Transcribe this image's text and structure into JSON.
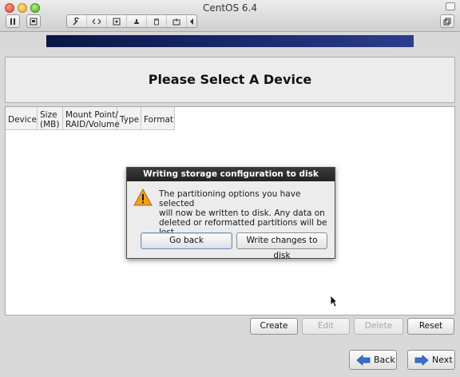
{
  "window": {
    "title": "CentOS 6.4"
  },
  "toolbar": {
    "items": [
      "pause-icon",
      "snapshot-icon",
      "wrench-icon",
      "network-icon",
      "disk-icon",
      "usb-icon",
      "trash-icon",
      "share-icon",
      "collapse-icon"
    ]
  },
  "installer": {
    "page_title": "Please Select A Device",
    "columns": [
      {
        "line1": "Device",
        "line2": ""
      },
      {
        "line1": "Size",
        "line2": "(MB)"
      },
      {
        "line1": "Mount Point/",
        "line2": "RAID/Volume"
      },
      {
        "line1": "Type",
        "line2": ""
      },
      {
        "line1": "Format",
        "line2": ""
      }
    ],
    "buttons": {
      "create": "Create",
      "edit": "Edit",
      "delete": "Delete",
      "reset": "Reset",
      "back": "Back",
      "next": "Next"
    }
  },
  "dialog": {
    "title": "Writing storage configuration to disk",
    "message_lines": [
      "The partitioning options you have selected",
      "will now be written to disk.  Any data on",
      "deleted or reformatted partitions will be lost."
    ],
    "go_back": "Go back",
    "write_changes": "Write changes to disk"
  },
  "colors": {
    "banner": "#1a2a6e",
    "warning": "#f0a020"
  }
}
